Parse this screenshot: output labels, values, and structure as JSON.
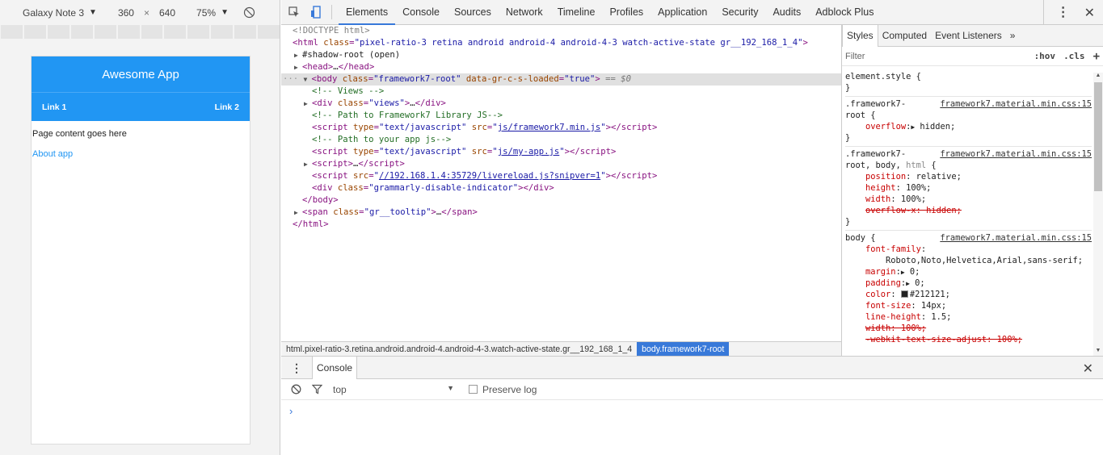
{
  "device_toolbar": {
    "device": "Galaxy Note 3",
    "width": "360",
    "times": "×",
    "height": "640",
    "zoom": "75%"
  },
  "app": {
    "title": "Awesome App",
    "link1": "Link 1",
    "link2": "Link 2",
    "content": "Page content goes here",
    "about": "About app"
  },
  "devtools": {
    "tabs": [
      "Elements",
      "Console",
      "Sources",
      "Network",
      "Timeline",
      "Profiles",
      "Application",
      "Security",
      "Audits",
      "Adblock Plus"
    ],
    "active_tab": "Elements",
    "breadcrumbs": [
      "html.pixel-ratio-3.retina.android.android-4.android-4-3.watch-active-state.gr__192_168_1_4",
      "body.framework7-root"
    ]
  },
  "styles_pane": {
    "tabs": [
      "Styles",
      "Computed",
      "Event Listeners",
      "»"
    ],
    "filter_placeholder": "Filter",
    "hov": ":hov",
    "cls": ".cls",
    "add": "+"
  },
  "console_drawer": {
    "tab": "Console",
    "context": "top",
    "preserve_log": "Preserve log",
    "prompt": "›"
  },
  "colors": {
    "app_blue": "#2196f3",
    "devtools_accent": "#3879d9",
    "body_color_swatch": "#212121"
  }
}
